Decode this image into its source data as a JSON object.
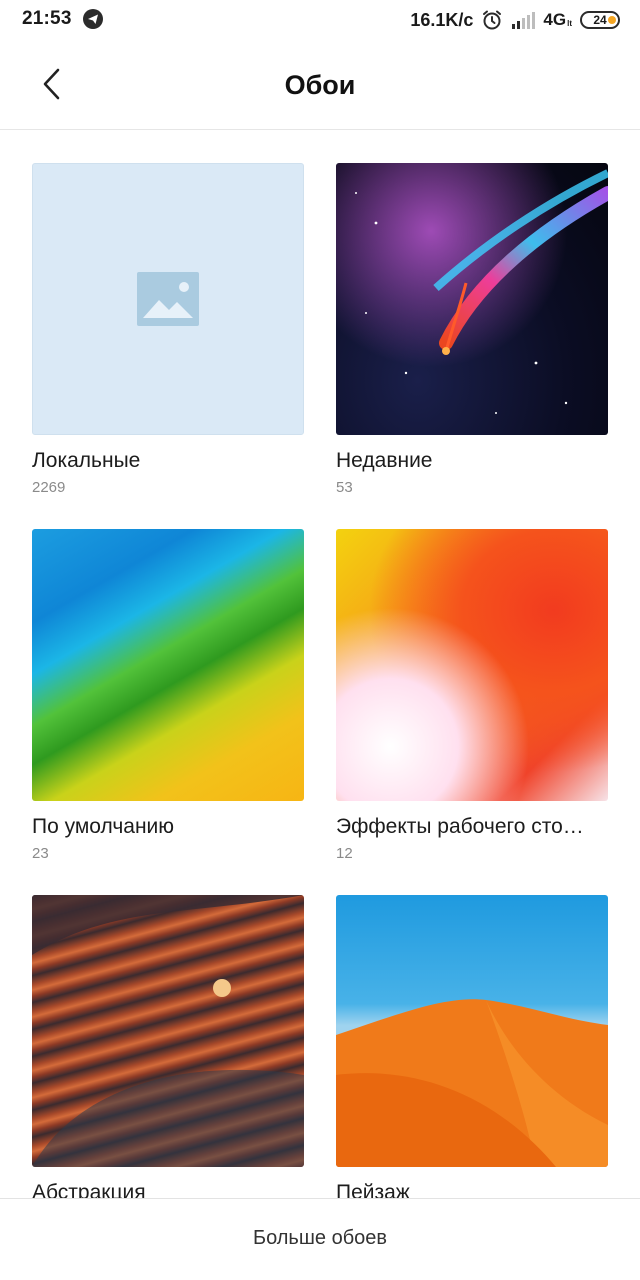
{
  "status_bar": {
    "time": "21:53",
    "net_speed": "16.1K/c",
    "network": "4G",
    "network_sub": "lt",
    "battery": "24",
    "icons": [
      "telegram-icon",
      "alarm-icon",
      "signal-icon",
      "battery-icon"
    ]
  },
  "header": {
    "title": "Обои",
    "back_icon": "chevron-left-icon"
  },
  "categories": [
    {
      "title": "Локальные",
      "count": "2269",
      "thumb": "placeholder-image"
    },
    {
      "title": "Недавние",
      "count": "53",
      "thumb": "space-comet"
    },
    {
      "title": "По умолчанию",
      "count": "23",
      "thumb": "blue-green-yellow-paint"
    },
    {
      "title": "Эффекты рабочего сто…",
      "count": "12",
      "thumb": "orange-red-pink-swirl"
    },
    {
      "title": "Абстракция",
      "count": "",
      "thumb": "layered-rock-waves"
    },
    {
      "title": "Пейзаж",
      "count": "",
      "thumb": "orange-desert-dune"
    }
  ],
  "bottom": {
    "more_label": "Больше обоев"
  },
  "colors": {
    "placeholder_bg": "#dae9f6",
    "placeholder_icon": "#aacbe0",
    "count_text": "#8a8a8a"
  }
}
